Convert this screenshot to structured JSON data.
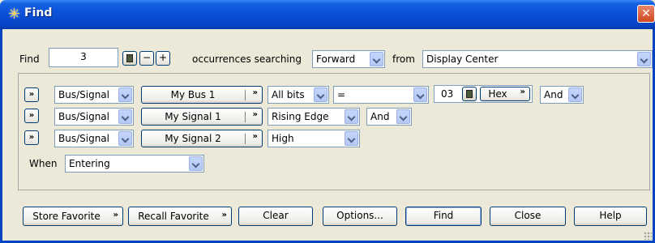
{
  "window": {
    "title": "Find",
    "close_symbol": "✕"
  },
  "find_row": {
    "find_label": "Find",
    "count_value": "3",
    "minus": "−",
    "plus": "+",
    "occurrences_label": "occurrences searching",
    "direction": "Forward",
    "from_label": "from",
    "from_value": "Display Center"
  },
  "criteria": [
    {
      "expander": "»",
      "kind": "Bus/Signal",
      "name": "My Bus 1",
      "field1": "All bits",
      "op": "=",
      "value": "03",
      "radix": "Hex",
      "logic": "And"
    },
    {
      "expander": "»",
      "kind": "Bus/Signal",
      "name": "My Signal 1",
      "field1": "Rising Edge",
      "logic": "And"
    },
    {
      "expander": "»",
      "kind": "Bus/Signal",
      "name": "My Signal 2",
      "field1": "High"
    }
  ],
  "when": {
    "label": "When",
    "value": "Entering"
  },
  "buttons": {
    "store_favorite": "Store Favorite",
    "recall_favorite": "Recall Favorite",
    "clear": "Clear",
    "options": "Options...",
    "find": "Find",
    "close": "Close",
    "help": "Help"
  },
  "chevron": "»"
}
